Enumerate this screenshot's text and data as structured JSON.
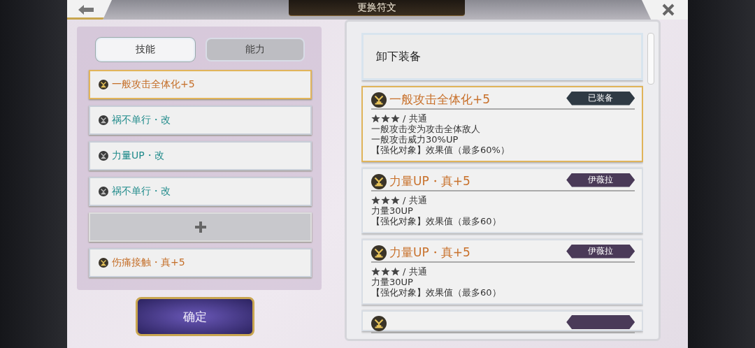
{
  "window": {
    "title": "更换符文"
  },
  "tabs": [
    {
      "label": "技能",
      "selected": true
    },
    {
      "label": "能力",
      "selected": false
    }
  ],
  "slots": [
    {
      "kind": "gold",
      "name": "一般攻击全体化+5",
      "selected": true
    },
    {
      "kind": "teal",
      "name": "祸不单行・改",
      "selected": false
    },
    {
      "kind": "teal",
      "name": "力量UP・改",
      "selected": false
    },
    {
      "kind": "teal",
      "name": "祸不单行・改",
      "selected": false
    },
    {
      "kind": "empty",
      "selected": false
    },
    {
      "kind": "gold",
      "name": "伤痛接触・真+5",
      "selected": false
    }
  ],
  "confirm_button": "确定",
  "unequip_button": "卸下装备",
  "runes": [
    {
      "kind": "full",
      "name": "一般攻击全体化+5",
      "tag": "已装备",
      "color": "#2f3a44",
      "selected": true,
      "stars": 3,
      "category": "/ 共通",
      "lines": [
        "一般攻击变为攻击全体敌人",
        "一般攻击威力30%UP",
        "【强化对象】效果值（最多60%）"
      ]
    },
    {
      "kind": "full",
      "name": "力量UP・真+5",
      "tag": "伊薇拉",
      "color": "#4a3a58",
      "selected": false,
      "stars": 3,
      "category": "/ 共通",
      "lines": [
        "力量30UP",
        "【强化对象】效果值（最多60）"
      ]
    },
    {
      "kind": "full",
      "name": "力量UP・真+5",
      "tag": "伊薇拉",
      "color": "#4a3a58",
      "selected": false,
      "stars": 3,
      "category": "/ 共通",
      "lines": [
        "力量30UP",
        "【强化对象】效果值（最多60）"
      ]
    },
    {
      "kind": "cut",
      "color": "#4a3a58",
      "selected": false
    }
  ]
}
